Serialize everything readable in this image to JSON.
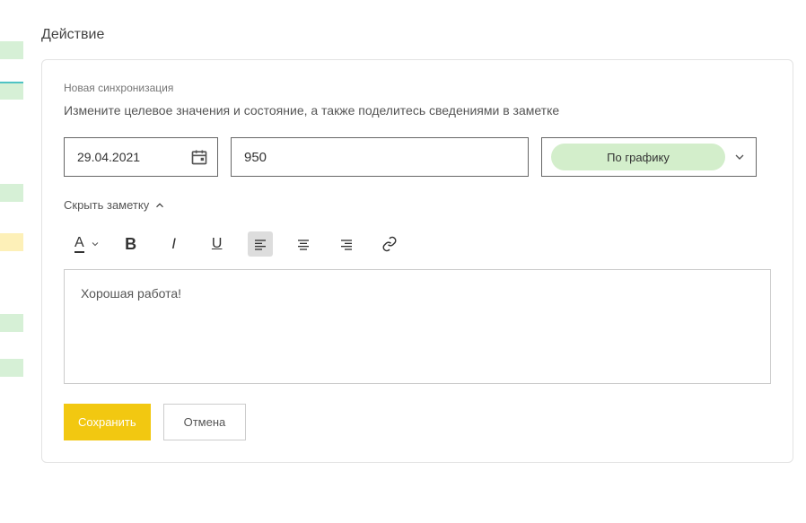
{
  "header": {
    "title": "Действие"
  },
  "sync": {
    "label": "Новая синхронизация",
    "description": "Измените целевое значения и состояние, а также поделитесь сведениями в заметке"
  },
  "form": {
    "date": "29.04.2021",
    "value": "950",
    "status": "По графику"
  },
  "note": {
    "toggle_label": "Скрыть заметку",
    "content": "Хорошая работа!"
  },
  "buttons": {
    "save": "Сохранить",
    "cancel": "Отмена"
  }
}
